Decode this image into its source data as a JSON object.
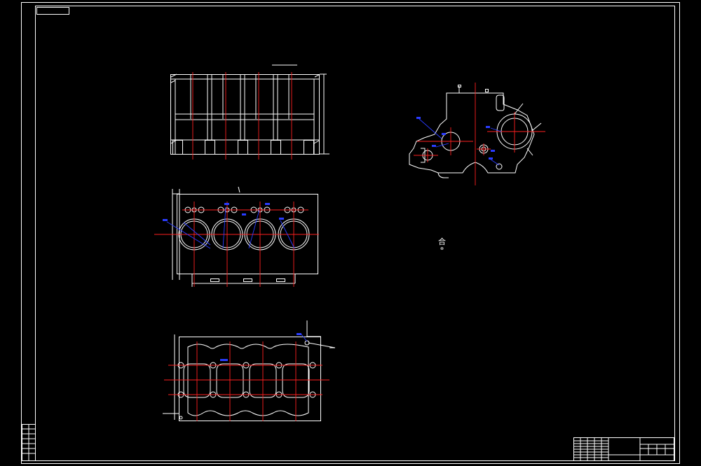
{
  "drawing": {
    "background": "#000000",
    "line_color": "#ffffff",
    "centerline_color": "#ff2020",
    "dimension_color": "#2a3cff"
  },
  "views": [
    {
      "id": "front-section-view"
    },
    {
      "id": "top-view",
      "cylinders": 4
    },
    {
      "id": "bottom-view",
      "cylinders": 4
    },
    {
      "id": "side-view"
    }
  ],
  "labels": {
    "center_mark": "合",
    "center_mark_sub": "⊗"
  }
}
